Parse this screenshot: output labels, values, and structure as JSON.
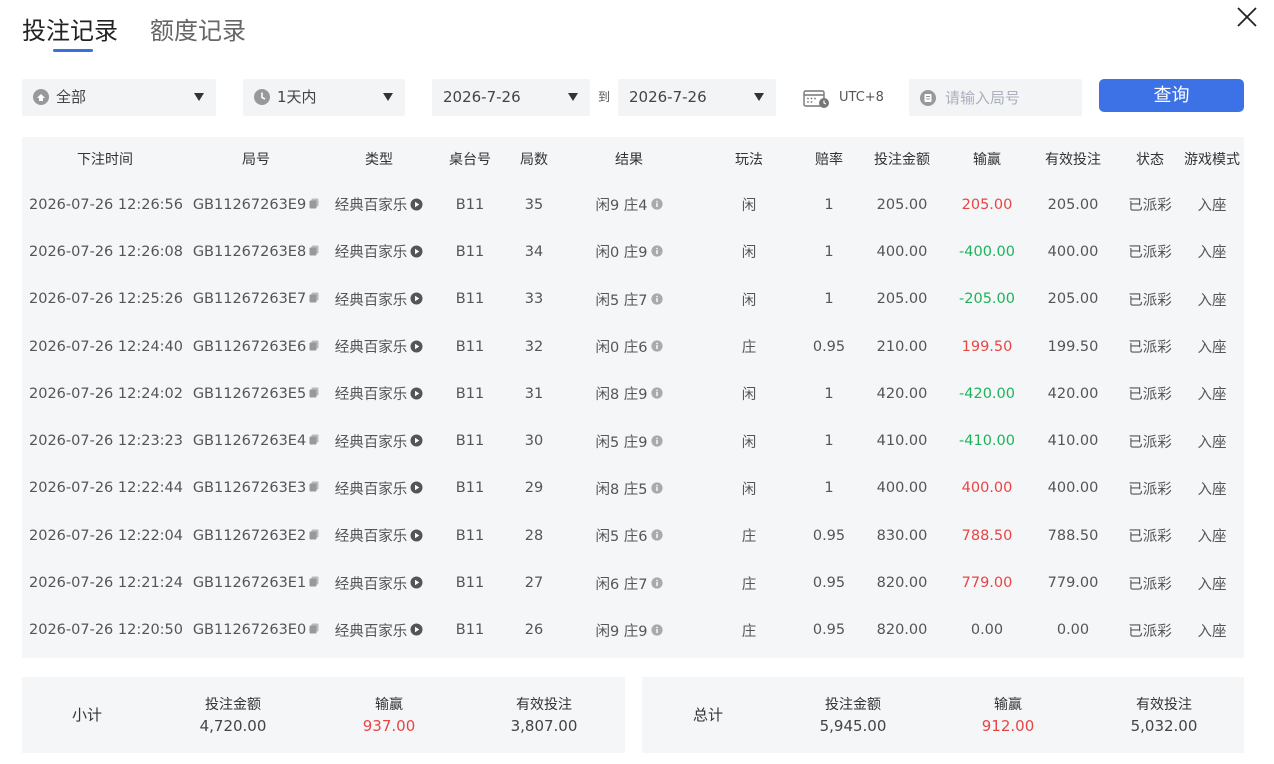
{
  "tabs": {
    "bets": "投注记录",
    "credit": "额度记录"
  },
  "filters": {
    "category": "全部",
    "time_range": "1天内",
    "start_date": "2026-7-26",
    "to": "到",
    "end_date": "2026-7-26",
    "timezone": "UTC+8",
    "search_placeholder": "请输入局号",
    "query_button": "查询"
  },
  "table": {
    "headers": [
      "下注时间",
      "局号",
      "类型",
      "桌台号",
      "局数",
      "结果",
      "玩法",
      "赔率",
      "投注金额",
      "输赢",
      "有效投注",
      "状态",
      "游戏模式"
    ],
    "rows": [
      {
        "time": "2026-07-26 12:26:56",
        "round_id": "GB11267263E9",
        "type": "经典百家乐",
        "table": "B11",
        "round": "35",
        "result": "闲9 庄4",
        "bet": "闲",
        "odds": "1",
        "amount": "205.00",
        "winloss": "205.00",
        "sign": "win",
        "valid": "205.00",
        "status": "已派彩",
        "mode": "入座"
      },
      {
        "time": "2026-07-26 12:26:08",
        "round_id": "GB11267263E8",
        "type": "经典百家乐",
        "table": "B11",
        "round": "34",
        "result": "闲0 庄9",
        "bet": "闲",
        "odds": "1",
        "amount": "400.00",
        "winloss": "-400.00",
        "sign": "loss",
        "valid": "400.00",
        "status": "已派彩",
        "mode": "入座"
      },
      {
        "time": "2026-07-26 12:25:26",
        "round_id": "GB11267263E7",
        "type": "经典百家乐",
        "table": "B11",
        "round": "33",
        "result": "闲5 庄7",
        "bet": "闲",
        "odds": "1",
        "amount": "205.00",
        "winloss": "-205.00",
        "sign": "loss",
        "valid": "205.00",
        "status": "已派彩",
        "mode": "入座"
      },
      {
        "time": "2026-07-26 12:24:40",
        "round_id": "GB11267263E6",
        "type": "经典百家乐",
        "table": "B11",
        "round": "32",
        "result": "闲0 庄6",
        "bet": "庄",
        "odds": "0.95",
        "amount": "210.00",
        "winloss": "199.50",
        "sign": "win",
        "valid": "199.50",
        "status": "已派彩",
        "mode": "入座"
      },
      {
        "time": "2026-07-26 12:24:02",
        "round_id": "GB11267263E5",
        "type": "经典百家乐",
        "table": "B11",
        "round": "31",
        "result": "闲8 庄9",
        "bet": "闲",
        "odds": "1",
        "amount": "420.00",
        "winloss": "-420.00",
        "sign": "loss",
        "valid": "420.00",
        "status": "已派彩",
        "mode": "入座"
      },
      {
        "time": "2026-07-26 12:23:23",
        "round_id": "GB11267263E4",
        "type": "经典百家乐",
        "table": "B11",
        "round": "30",
        "result": "闲5 庄9",
        "bet": "闲",
        "odds": "1",
        "amount": "410.00",
        "winloss": "-410.00",
        "sign": "loss",
        "valid": "410.00",
        "status": "已派彩",
        "mode": "入座"
      },
      {
        "time": "2026-07-26 12:22:44",
        "round_id": "GB11267263E3",
        "type": "经典百家乐",
        "table": "B11",
        "round": "29",
        "result": "闲8 庄5",
        "bet": "闲",
        "odds": "1",
        "amount": "400.00",
        "winloss": "400.00",
        "sign": "win",
        "valid": "400.00",
        "status": "已派彩",
        "mode": "入座"
      },
      {
        "time": "2026-07-26 12:22:04",
        "round_id": "GB11267263E2",
        "type": "经典百家乐",
        "table": "B11",
        "round": "28",
        "result": "闲5 庄6",
        "bet": "庄",
        "odds": "0.95",
        "amount": "830.00",
        "winloss": "788.50",
        "sign": "win",
        "valid": "788.50",
        "status": "已派彩",
        "mode": "入座"
      },
      {
        "time": "2026-07-26 12:21:24",
        "round_id": "GB11267263E1",
        "type": "经典百家乐",
        "table": "B11",
        "round": "27",
        "result": "闲6 庄7",
        "bet": "庄",
        "odds": "0.95",
        "amount": "820.00",
        "winloss": "779.00",
        "sign": "win",
        "valid": "779.00",
        "status": "已派彩",
        "mode": "入座"
      },
      {
        "time": "2026-07-26 12:20:50",
        "round_id": "GB11267263E0",
        "type": "经典百家乐",
        "table": "B11",
        "round": "26",
        "result": "闲9 庄9",
        "bet": "庄",
        "odds": "0.95",
        "amount": "820.00",
        "winloss": "0.00",
        "sign": "zero",
        "valid": "0.00",
        "status": "已派彩",
        "mode": "入座"
      }
    ]
  },
  "subtotal": {
    "label": "小计",
    "amount_label": "投注金额",
    "amount": "4,720.00",
    "winloss_label": "输赢",
    "winloss": "937.00",
    "valid_label": "有效投注",
    "valid": "3,807.00"
  },
  "total": {
    "label": "总计",
    "amount_label": "投注金额",
    "amount": "5,945.00",
    "winloss_label": "输赢",
    "winloss": "912.00",
    "valid_label": "有效投注",
    "valid": "5,032.00"
  },
  "colors": {
    "accent": "#3d72e6",
    "win": "#e84545",
    "loss": "#1cb45a"
  }
}
